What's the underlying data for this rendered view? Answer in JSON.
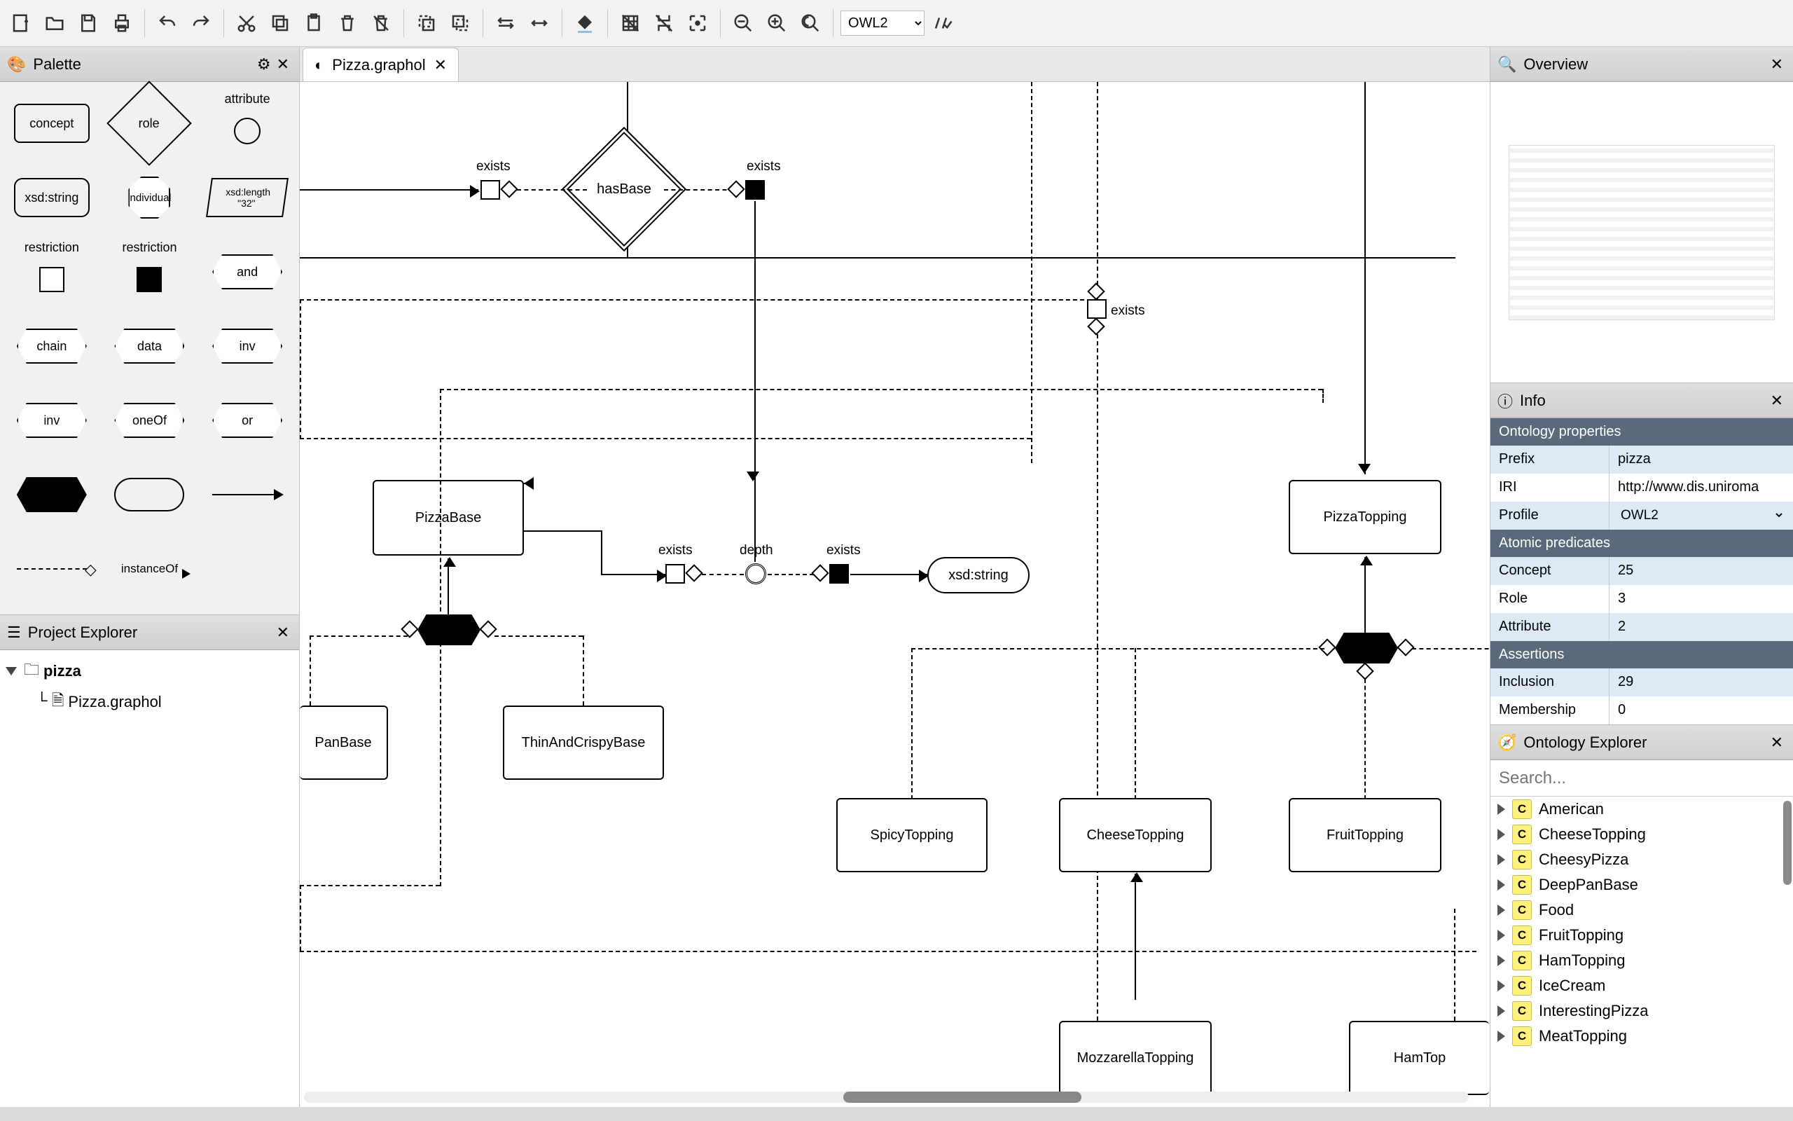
{
  "toolbar": {
    "profile_value": "OWL2"
  },
  "tab": {
    "filename": "Pizza.graphol"
  },
  "palette": {
    "title": "Palette",
    "items": {
      "concept": "concept",
      "role": "role",
      "attribute": "attribute",
      "xsdstring": "xsd:string",
      "individual": "individual",
      "facet_top": "xsd:length",
      "facet_bot": "\"32\"",
      "restriction": "restriction",
      "and": "and",
      "chain": "chain",
      "data": "data",
      "inv1": "inv",
      "inv2": "inv",
      "oneOf": "oneOf",
      "or": "or",
      "instanceOf": "instanceOf"
    }
  },
  "project_explorer": {
    "title": "Project Explorer",
    "root": "pizza",
    "file": "Pizza.graphol"
  },
  "diagram": {
    "hasBase": "hasBase",
    "exists": "exists",
    "depth": "depth",
    "PizzaBase": "PizzaBase",
    "ThinAndCrispyBase": "ThinAndCrispyBase",
    "PanBase": "PanBase",
    "xsdstring": "xsd:string",
    "PizzaTopping": "PizzaTopping",
    "SpicyTopping": "SpicyTopping",
    "CheeseTopping": "CheeseTopping",
    "FruitTopping": "FruitTopping",
    "MozzarellaTopping": "MozzarellaTopping",
    "HamTopping": "HamTop"
  },
  "overview": {
    "title": "Overview"
  },
  "info": {
    "title": "Info",
    "sections": {
      "ontprops": "Ontology properties",
      "atomic": "Atomic predicates",
      "assertions": "Assertions"
    },
    "prefix_k": "Prefix",
    "prefix_v": "pizza",
    "iri_k": "IRI",
    "iri_v": "http://www.dis.uniroma",
    "profile_k": "Profile",
    "profile_v": "OWL2",
    "concept_k": "Concept",
    "concept_v": "25",
    "role_k": "Role",
    "role_v": "3",
    "attribute_k": "Attribute",
    "attribute_v": "2",
    "inclusion_k": "Inclusion",
    "inclusion_v": "29",
    "membership_k": "Membership",
    "membership_v": "0"
  },
  "ontology_explorer": {
    "title": "Ontology Explorer",
    "search_placeholder": "Search...",
    "items": [
      "American",
      "CheeseTopping",
      "CheesyPizza",
      "DeepPanBase",
      "Food",
      "FruitTopping",
      "HamTopping",
      "IceCream",
      "InterestingPizza",
      "MeatTopping"
    ]
  }
}
